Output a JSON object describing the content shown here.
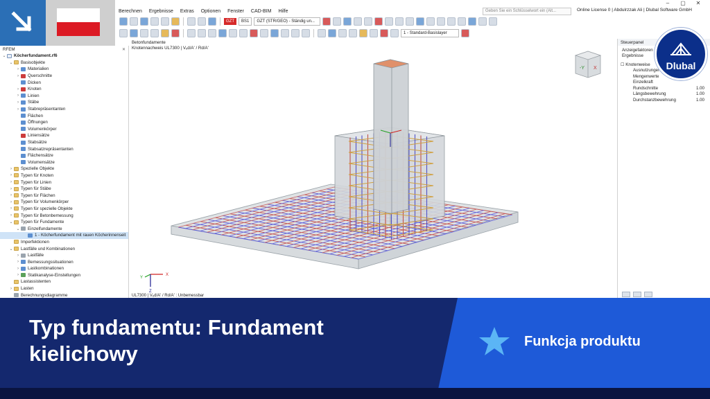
{
  "app": {
    "menu": [
      "Berechnen",
      "Ergebnisse",
      "Extras",
      "Optionen",
      "Fenster",
      "CAD-BIM",
      "Hilfe"
    ],
    "search_placeholder": "Geben Sie ein Schlüsselwort ein (Alt...",
    "license": "Online License 0 | Abdulrzzak Ali | Dlubal Software GmbH",
    "window_controls": [
      "–",
      "▢",
      "✕"
    ],
    "combo_bs": "BS1",
    "combo_gzt_tag": "GZT",
    "combo_gzt": "GZT (STR/GEO) - Ständig un...",
    "combo_layer": "1 - Standard-Basislayer"
  },
  "navigator": {
    "title": "RFEM",
    "tree": [
      {
        "label": "Köcherfundament.rf6",
        "indent": 0,
        "tw": "⌄",
        "icon": "file",
        "bold": true
      },
      {
        "label": "Basisobjekte",
        "indent": 1,
        "tw": "⌄",
        "icon": "folder"
      },
      {
        "label": "Materialien",
        "indent": 2,
        "tw": "›",
        "icon": "blue"
      },
      {
        "label": "Querschnitte",
        "indent": 2,
        "tw": "›",
        "icon": "red"
      },
      {
        "label": "Dicken",
        "indent": 2,
        "tw": "",
        "icon": "blue"
      },
      {
        "label": "Knoten",
        "indent": 2,
        "tw": "›",
        "icon": "red"
      },
      {
        "label": "Linien",
        "indent": 2,
        "tw": "›",
        "icon": "blue"
      },
      {
        "label": "Stäbe",
        "indent": 2,
        "tw": "›",
        "icon": "blue"
      },
      {
        "label": "Stabrepräsentanten",
        "indent": 2,
        "tw": "›",
        "icon": "blue"
      },
      {
        "label": "Flächen",
        "indent": 2,
        "tw": "",
        "icon": "blue"
      },
      {
        "label": "Öffnungen",
        "indent": 2,
        "tw": "",
        "icon": "blue"
      },
      {
        "label": "Volumenkörper",
        "indent": 2,
        "tw": "",
        "icon": "blue"
      },
      {
        "label": "Liniensätze",
        "indent": 2,
        "tw": "",
        "icon": "red"
      },
      {
        "label": "Stabsätze",
        "indent": 2,
        "tw": "",
        "icon": "blue"
      },
      {
        "label": "Stabsatzrepräsentanten",
        "indent": 2,
        "tw": "",
        "icon": "blue"
      },
      {
        "label": "Flächensätze",
        "indent": 2,
        "tw": "",
        "icon": "blue"
      },
      {
        "label": "Volumensätze",
        "indent": 2,
        "tw": "",
        "icon": "blue"
      },
      {
        "label": "Spezielle Objekte",
        "indent": 1,
        "tw": "›",
        "icon": "folder"
      },
      {
        "label": "Typen für Knoten",
        "indent": 1,
        "tw": "›",
        "icon": "folder"
      },
      {
        "label": "Typen für Linien",
        "indent": 1,
        "tw": "›",
        "icon": "folder"
      },
      {
        "label": "Typen für Stäbe",
        "indent": 1,
        "tw": "›",
        "icon": "folder"
      },
      {
        "label": "Typen für Flächen",
        "indent": 1,
        "tw": "›",
        "icon": "folder"
      },
      {
        "label": "Typen für Volumenkörper",
        "indent": 1,
        "tw": "›",
        "icon": "folder"
      },
      {
        "label": "Typen für spezielle Objekte",
        "indent": 1,
        "tw": "›",
        "icon": "folder"
      },
      {
        "label": "Typen für Betonbemessung",
        "indent": 1,
        "tw": "›",
        "icon": "folder"
      },
      {
        "label": "Typen für Fundamente",
        "indent": 1,
        "tw": "⌄",
        "icon": "folder"
      },
      {
        "label": "Einzelfundamente",
        "indent": 2,
        "tw": "⌄",
        "icon": "gray"
      },
      {
        "label": "1 - Köcherfundament mit rauen Köcherinnenseit",
        "indent": 3,
        "tw": "",
        "icon": "blue",
        "selected": true
      },
      {
        "label": "Imperfektionen",
        "indent": 1,
        "tw": "",
        "icon": "folder"
      },
      {
        "label": "Lastfälle und Kombinationen",
        "indent": 1,
        "tw": "⌄",
        "icon": "folder"
      },
      {
        "label": "Lastfälle",
        "indent": 2,
        "tw": "›",
        "icon": "gray"
      },
      {
        "label": "Bemessungssituationen",
        "indent": 2,
        "tw": "›",
        "icon": "blue"
      },
      {
        "label": "Lastkombinationen",
        "indent": 2,
        "tw": "›",
        "icon": "blue"
      },
      {
        "label": "Statikanalyse-Einstellungen",
        "indent": 2,
        "tw": "›",
        "icon": "green"
      },
      {
        "label": "Lastassistenten",
        "indent": 1,
        "tw": "",
        "icon": "folder"
      },
      {
        "label": "Lasten",
        "indent": 1,
        "tw": "›",
        "icon": "folder"
      },
      {
        "label": "Berechnungsdiagramme",
        "indent": 1,
        "tw": "",
        "icon": "gray"
      }
    ]
  },
  "viewport": {
    "title": "Betonfundamente",
    "subtitle": "Knotennachweis UL7300 | Vₑd/A' / Rd/A'",
    "footer": "UL7300 | Vₑd/A' / Rd/A' : Unbemessbar",
    "axis_x": "X",
    "axis_y": "Y",
    "axis_z": "Z",
    "cube_label": "-Y"
  },
  "panel": {
    "title": "Steuerpanel",
    "lines": [
      "Anzeigefaktoren",
      "Ergebnisse"
    ],
    "group": "Knotenweise",
    "rows": [
      {
        "label": "Ausnutzungen",
        "value": ""
      },
      {
        "label": "Mengenwerte",
        "value": ""
      },
      {
        "label": "Einzelkraft",
        "value": ""
      },
      {
        "label": "Rundschnitte",
        "value": "1.00"
      },
      {
        "label": "Längsbewehrung",
        "value": "1.00"
      },
      {
        "label": "Durchstanzbewehrung",
        "value": "1.00"
      }
    ]
  },
  "logo": {
    "text": "Dlubal"
  },
  "banner": {
    "headline_line1": "Typ fundamentu: Fundament",
    "headline_line2": "kielichowy",
    "product": "Funkcja produktu"
  },
  "colors": {
    "banner_dark": "#14286e",
    "banner_light": "#1e5ad8",
    "flag_red": "#dc1a24",
    "accent_blue": "#2b6fb6"
  }
}
